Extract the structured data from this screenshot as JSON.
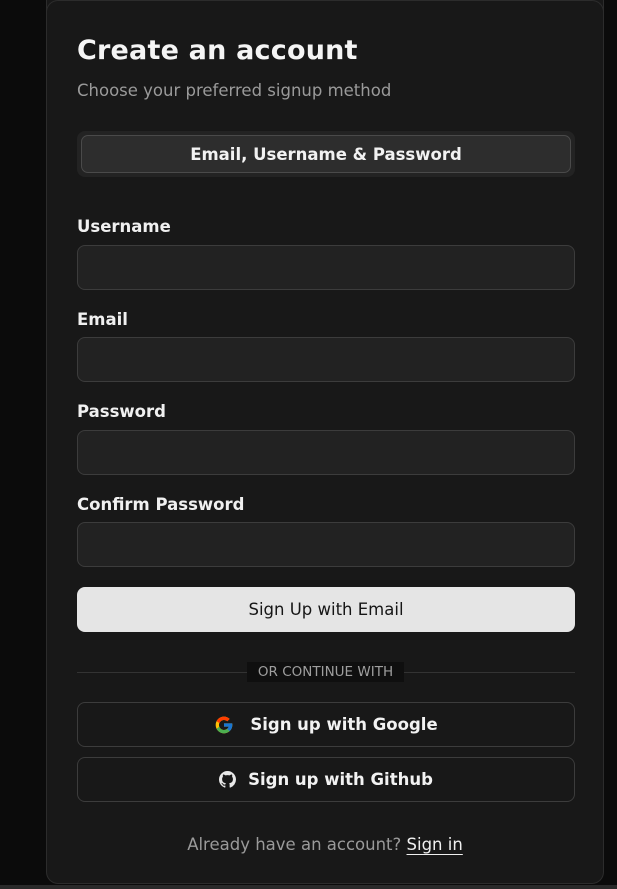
{
  "header": {
    "title": "Create an account",
    "subtitle": "Choose your preferred signup method"
  },
  "tabs": [
    {
      "label": "Email, Username & Password",
      "active": true
    }
  ],
  "fields": {
    "username": {
      "label": "Username",
      "value": ""
    },
    "email": {
      "label": "Email",
      "value": ""
    },
    "password": {
      "label": "Password",
      "value": ""
    },
    "confirm_password": {
      "label": "Confirm Password",
      "value": ""
    }
  },
  "primary_button": {
    "label": "Sign Up with Email"
  },
  "divider": {
    "text": "OR CONTINUE WITH"
  },
  "social": {
    "google": {
      "label": "Sign up with Google",
      "icon": "google-icon"
    },
    "github": {
      "label": "Sign up with Github",
      "icon": "github-icon"
    }
  },
  "footer": {
    "prompt": "Already have an account?",
    "link": "Sign in"
  },
  "colors": {
    "background": "#0b0b0b",
    "card": "#181818",
    "primary_button": "#e5e5e5",
    "input_background": "#222222",
    "border": "#3c3c3c"
  }
}
